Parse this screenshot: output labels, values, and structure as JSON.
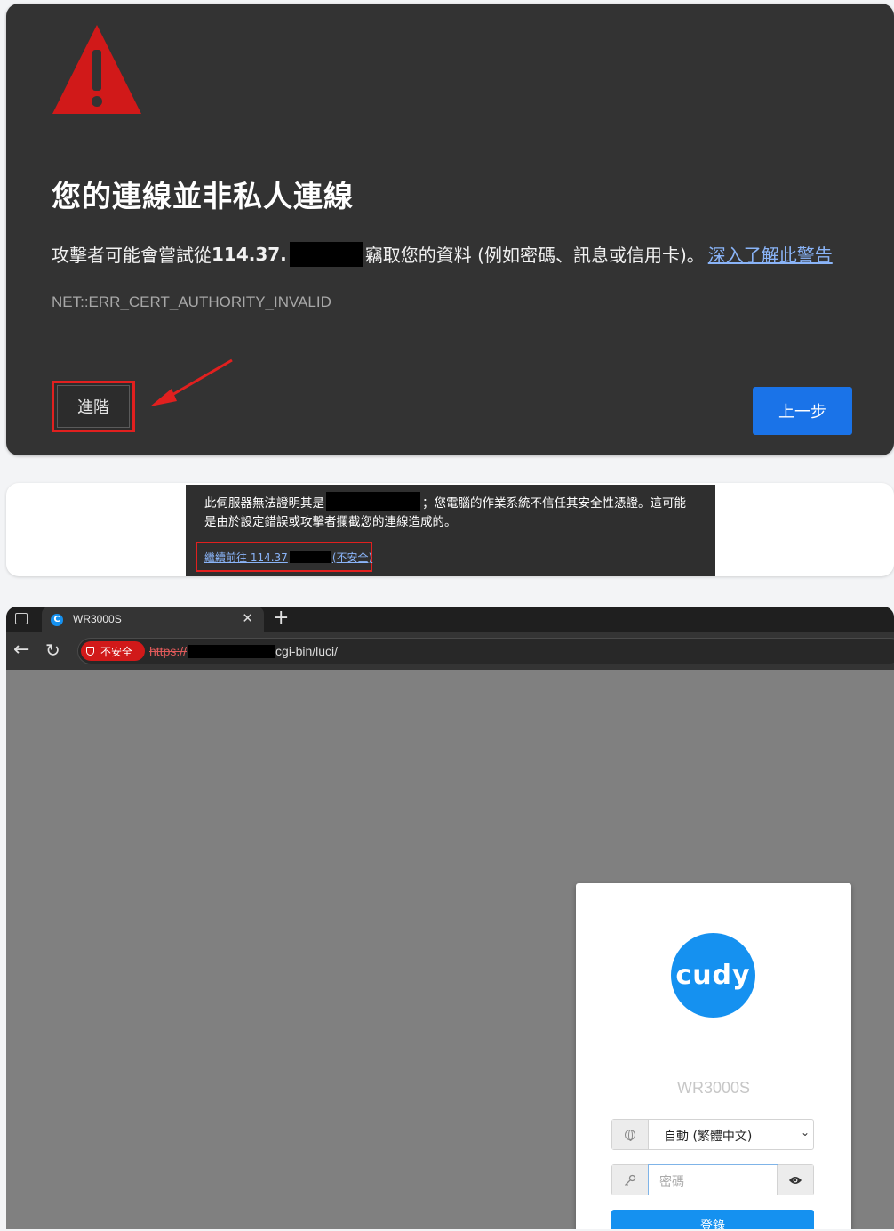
{
  "warning_page": {
    "title": "您的連線並非私人連線",
    "desc_prefix": "攻擊者可能會嘗試從",
    "ip_prefix": "114.37.",
    "desc_suffix": "竊取您的資料 (例如密碼、訊息或信用卡)。",
    "learn_more": "深入了解此警告",
    "error_code": "NET::ERR_CERT_AUTHORITY_INVALID",
    "advanced_button": "進階",
    "back_button": "上一步",
    "colors": {
      "background": "#333333",
      "primary": "#1a73e8",
      "highlight": "#e1201f",
      "warning_icon": "#d11919"
    }
  },
  "advanced_details": {
    "line1_prefix": "此伺服器無法證明其是",
    "line1_suffix": "；您電腦的作業系統不信任其安全性憑證。這可能",
    "line2": "是由於設定錯誤或攻擊者攔截您的連線造成的。",
    "proceed_prefix": "繼續前往 114.37",
    "proceed_suffix": "(不安全)"
  },
  "browser": {
    "tab_title": "WR3000S",
    "favicon_letter": "C",
    "not_secure_label": "不安全",
    "url_scheme": "https://",
    "url_path": "cgi-bin/luci/",
    "icons": [
      "sidebar-toggle-icon",
      "close-icon",
      "plus-icon",
      "back-arrow-icon",
      "reload-icon",
      "shield-icon"
    ]
  },
  "login": {
    "logo_text": "cudy",
    "model": "WR3000S",
    "language_value": "自動 (繁體中文)",
    "password_placeholder": "密碼",
    "login_button": "登錄",
    "colors": {
      "brand": "#1591f0"
    },
    "icons": [
      "globe-icon",
      "key-icon",
      "eye-icon",
      "chevron-down-icon"
    ]
  }
}
